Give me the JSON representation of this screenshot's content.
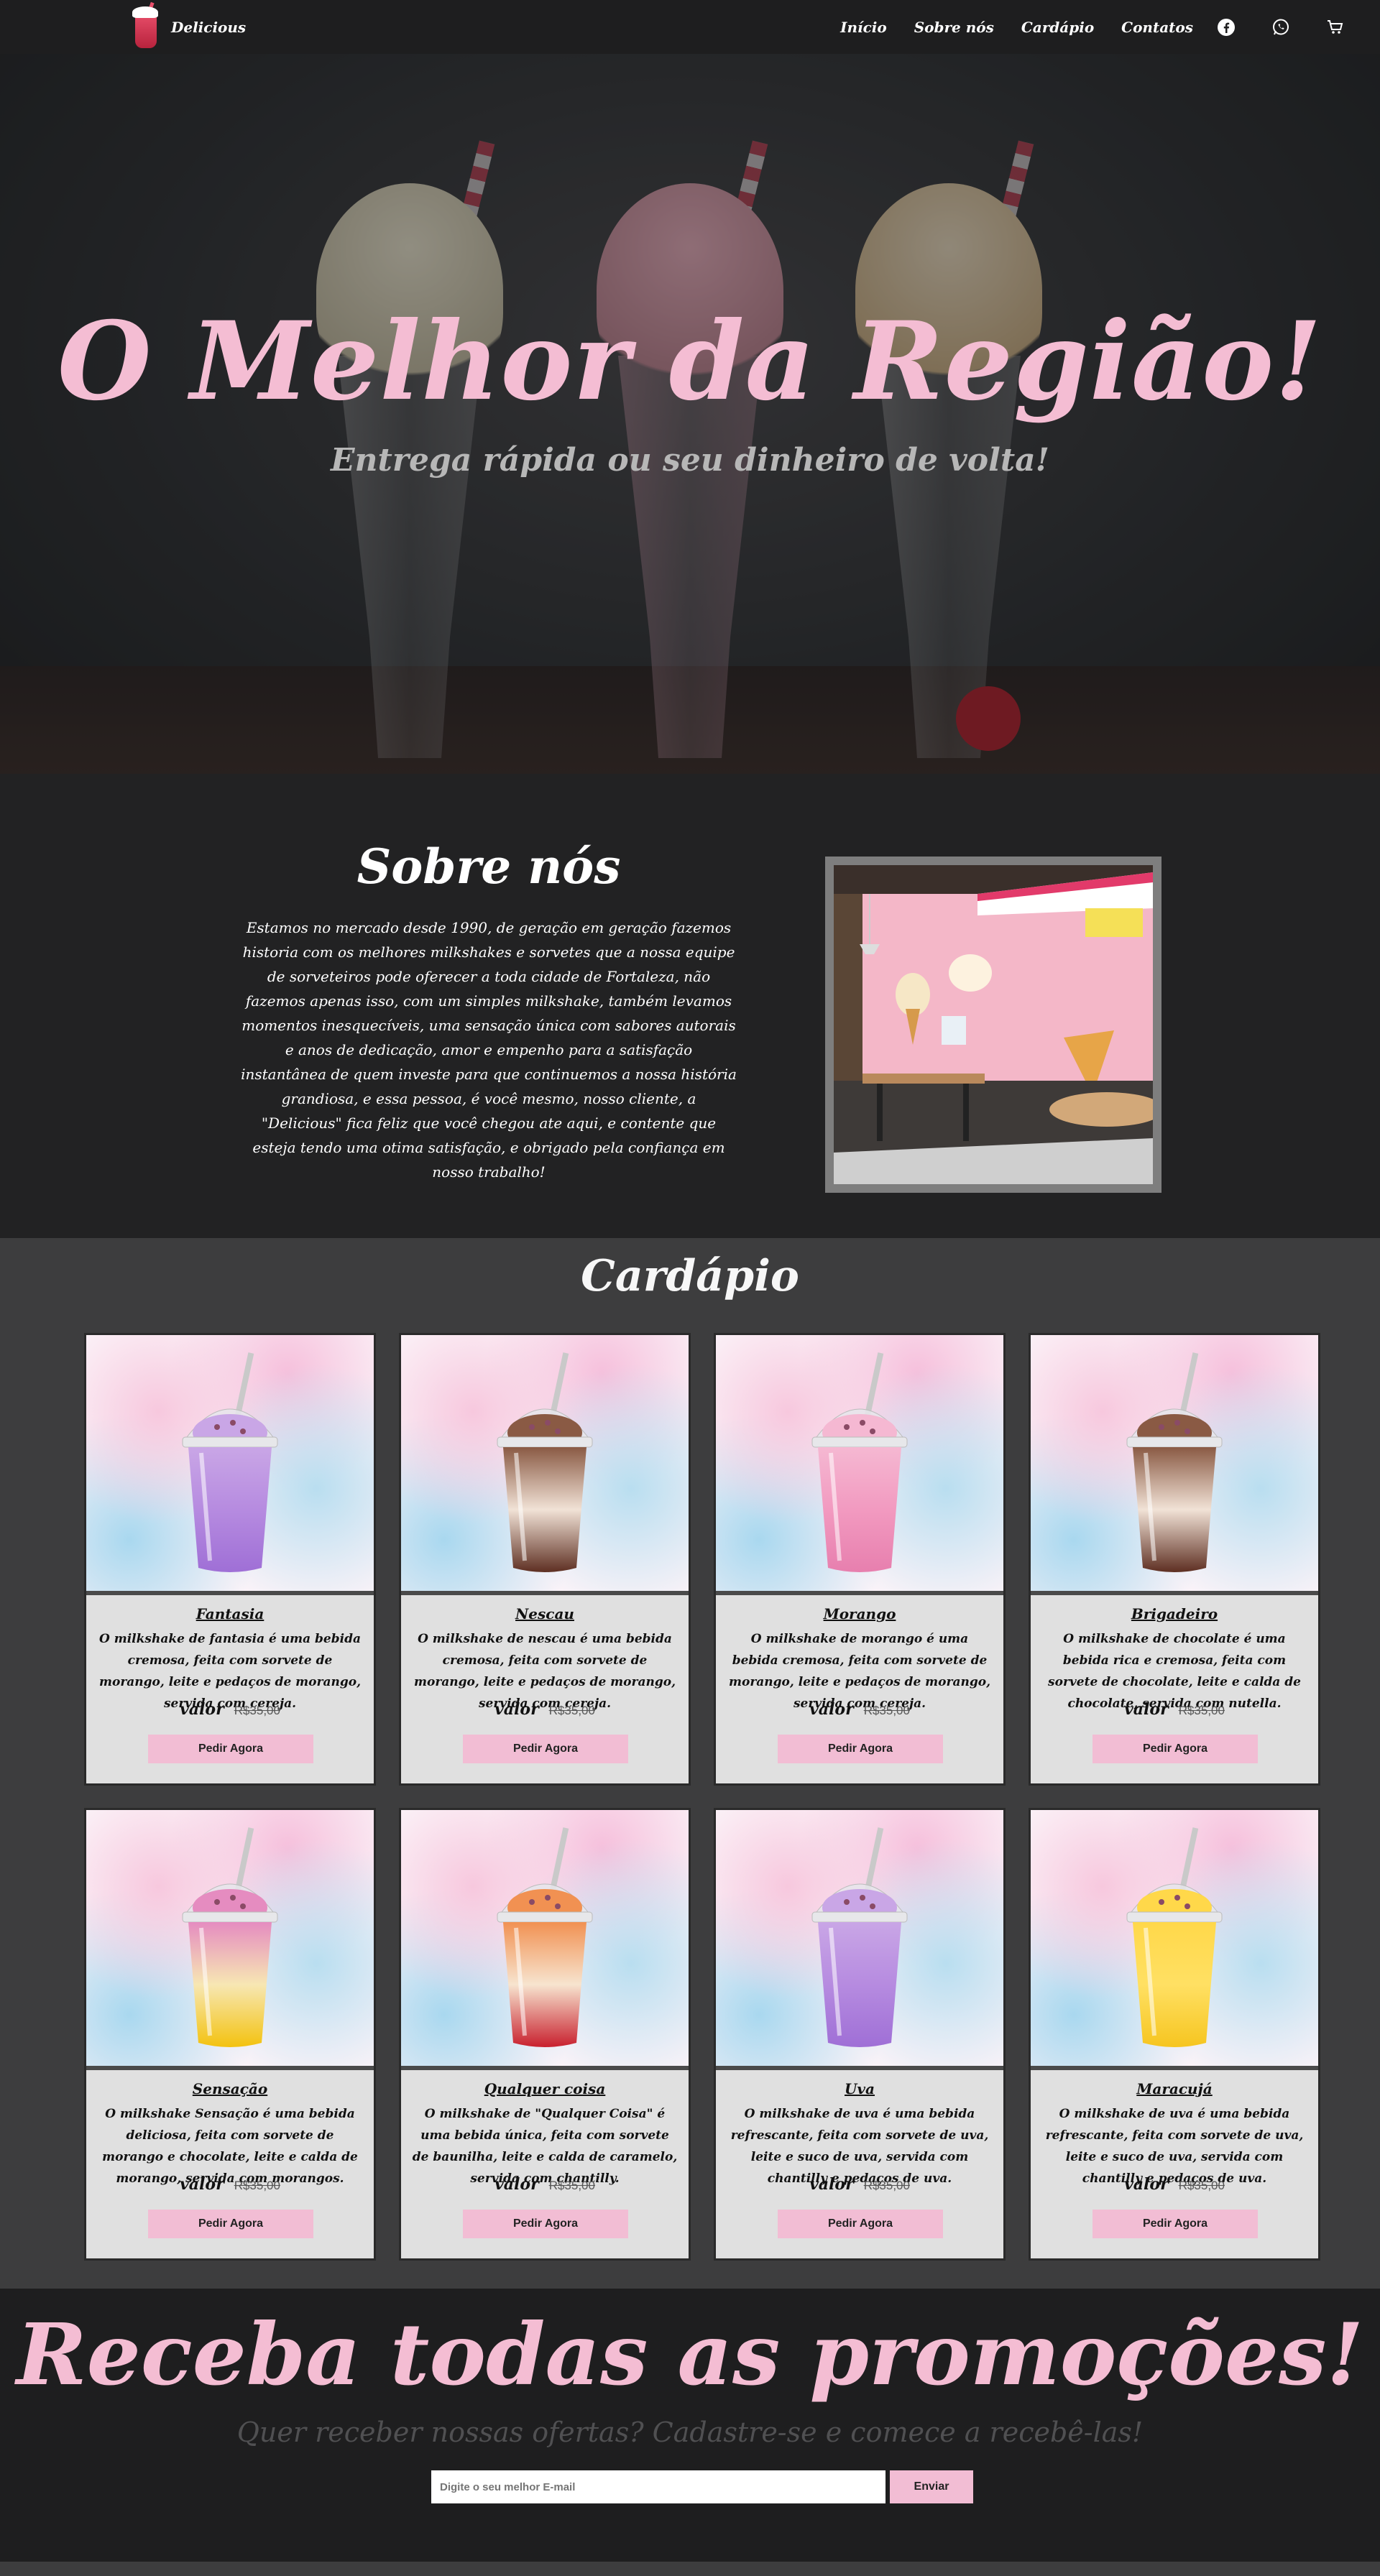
{
  "nav": {
    "brand": "Delicious",
    "links": [
      "Início",
      "Sobre nós",
      "Cardápio",
      "Contatos"
    ],
    "icons": [
      "facebook-icon",
      "whatsapp-icon",
      "cart-icon"
    ]
  },
  "hero": {
    "title": "O Melhor da Região!",
    "subtitle": "Entrega rápida ou seu dinheiro de volta!"
  },
  "about": {
    "title": "Sobre nós",
    "text": "Estamos no mercado desde 1990, de geração em geração fazemos historia com os melhores milkshakes e sorvetes que a nossa equipe de sorveteiros pode oferecer a toda cidade de Fortaleza, não fazemos apenas isso, com um simples milkshake, também levamos momentos inesquecíveis, uma sensação única com sabores autorais e anos de dedicação, amor e empenho para a satisfação instantânea de quem investe para que continuemos a nossa história grandiosa, e essa pessoa, é você mesmo, nosso cliente, a \"Delicious\" fica feliz que você chegou ate aqui, e contente que esteja tendo uma otima satisfação, e obrigado pela confiança em nosso trabalho!"
  },
  "menu": {
    "title": "Cardápio",
    "price_label": "valor",
    "button_label": "Pedir Agora",
    "items": [
      {
        "name": "Fantasia",
        "desc": "O milkshake de fantasia é uma bebida cremosa, feita com sorvete de morango, leite e pedaços de morango, servida com cereja.",
        "price": "R$35,00",
        "colors": {
          "top": "#c9a6e6",
          "mid": "#b68be0",
          "bottom": "#9f6fd6"
        }
      },
      {
        "name": "Nescau",
        "desc": "O milkshake de nescau é uma bebida cremosa, feita com sorvete de morango, leite e pedaços de morango, servida com cereja.",
        "price": "R$35,00",
        "colors": {
          "top": "#8a5a44",
          "mid": "#f1e2d6",
          "bottom": "#5e2f22"
        }
      },
      {
        "name": "Morango",
        "desc": "O milkshake de morango é uma bebida cremosa, feita com sorvete de morango, leite e pedaços de morango, servida com cereja.",
        "price": "R$35,00",
        "colors": {
          "top": "#f5b8d2",
          "mid": "#f29ac0",
          "bottom": "#e77fae"
        }
      },
      {
        "name": "Brigadeiro",
        "desc": "O milkshake de chocolate é uma bebida rica e cremosa, feita com sorvete de chocolate, leite e calda de chocolate, servida com nutella.",
        "price": "R$35,00",
        "colors": {
          "top": "#8a5a44",
          "mid": "#f1e2d6",
          "bottom": "#5e2f22"
        }
      },
      {
        "name": "Sensação",
        "desc": "O milkshake Sensação é uma bebida deliciosa, feita com sorvete de morango e chocolate, leite e calda de morango, servida com morangos.",
        "price": "R$35,00",
        "colors": {
          "top": "#e58cc0",
          "mid": "#f7e7b3",
          "bottom": "#f3c20f"
        }
      },
      {
        "name": "Qualquer coisa",
        "desc": "O milkshake de \"Qualquer Coisa\" é uma bebida única, feita com sorvete de baunilha, leite e calda de caramelo, servida com chantilly.",
        "price": "R$35,00",
        "colors": {
          "top": "#f19152",
          "mid": "#f7e4cf",
          "bottom": "#c8202e"
        }
      },
      {
        "name": "Uva",
        "desc": "O milkshake de uva é uma bebida refrescante, feita com sorvete de uva, leite e suco de uva, servida com chantilly e pedaços de uva.",
        "price": "R$35,00",
        "colors": {
          "top": "#c9a6e6",
          "mid": "#b68be0",
          "bottom": "#9f6fd6"
        }
      },
      {
        "name": "Maracujá",
        "desc": "O milkshake de uva é uma bebida refrescante, feita com sorvete de uva, leite e suco de uva, servida com chantilly e pedaços de uva.",
        "price": "R$35,00",
        "colors": {
          "top": "#ffd84a",
          "mid": "#ffe063",
          "bottom": "#f6c520"
        }
      }
    ]
  },
  "newsletter": {
    "title": "Receba todas as promoções!",
    "subtitle": "Quer receber nossas ofertas? Cadastre-se e comece a recebê-las!",
    "placeholder": "Digite o seu melhor E-mail",
    "button": "Enviar"
  },
  "colors": {
    "accent_pink": "#f4bdd3",
    "dark_bg": "#1e1e1f",
    "menu_bg": "#3d3d3e"
  }
}
